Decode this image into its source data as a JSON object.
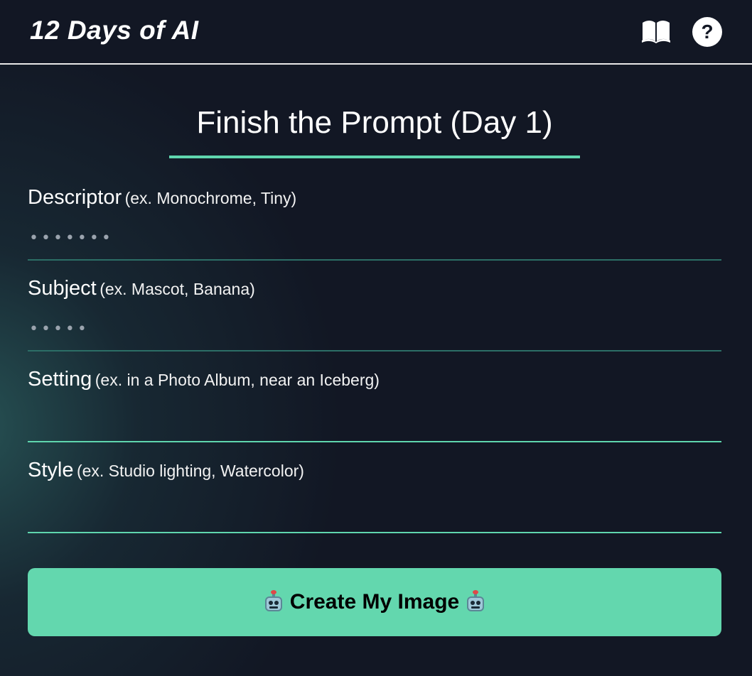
{
  "header": {
    "app_title": "12 Days of AI",
    "icons": [
      "book-icon",
      "help-icon"
    ],
    "help_glyph": "?"
  },
  "main": {
    "page_title": "Finish the Prompt (Day 1)",
    "accent_color": "#5fd6ae",
    "fields": [
      {
        "name": "Descriptor",
        "hint": "(ex. Monochrome, Tiny)",
        "value": "•••••••"
      },
      {
        "name": "Subject",
        "hint": "(ex. Mascot, Banana)",
        "value": "•••••"
      },
      {
        "name": "Setting",
        "hint": "(ex. in a Photo Album, near an Iceberg)",
        "value": ""
      },
      {
        "name": "Style",
        "hint": "(ex. Studio lighting, Watercolor)",
        "value": ""
      }
    ],
    "create_button": {
      "label": "Create My Image",
      "icon": "robot-icon",
      "color": "#63d7ae"
    }
  }
}
